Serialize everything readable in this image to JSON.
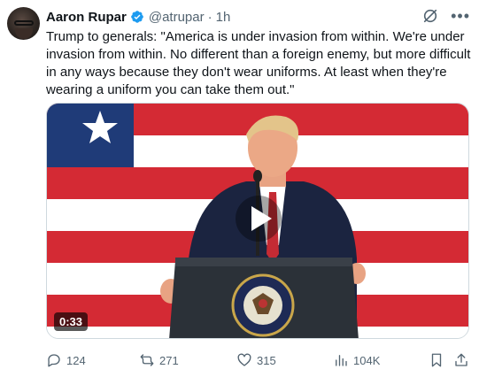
{
  "author": {
    "name": "Aaron Rupar",
    "handle": "@atrupar",
    "separator": "·",
    "time": "1h"
  },
  "tweet": {
    "text": "Trump to generals: \"America is under invasion from within. We're under invasion from within. No different than a foreign enemy, but more difficult in any ways because they don't wear uniforms. At least when they're wearing a uniform you can take them out.\""
  },
  "media": {
    "duration": "0:33",
    "seal_text": "SEAL OF THE PRESIDENT OF THE UNITED STATES"
  },
  "actions": {
    "replies": "124",
    "reposts": "271",
    "likes": "315",
    "views": "104K"
  },
  "icons": {
    "verified": "verified-badge-icon",
    "grok": "grok-icon",
    "more": "more-icon",
    "reply": "reply-icon",
    "repost": "repost-icon",
    "like": "heart-icon",
    "views": "views-icon",
    "bookmark": "bookmark-icon",
    "share": "share-icon",
    "play": "play-icon"
  },
  "colors": {
    "verified_blue": "#1d9bf0",
    "text_primary": "#0f1419",
    "text_secondary": "#536471",
    "flag_red": "#d42a34",
    "flag_blue": "#1f3b78"
  }
}
